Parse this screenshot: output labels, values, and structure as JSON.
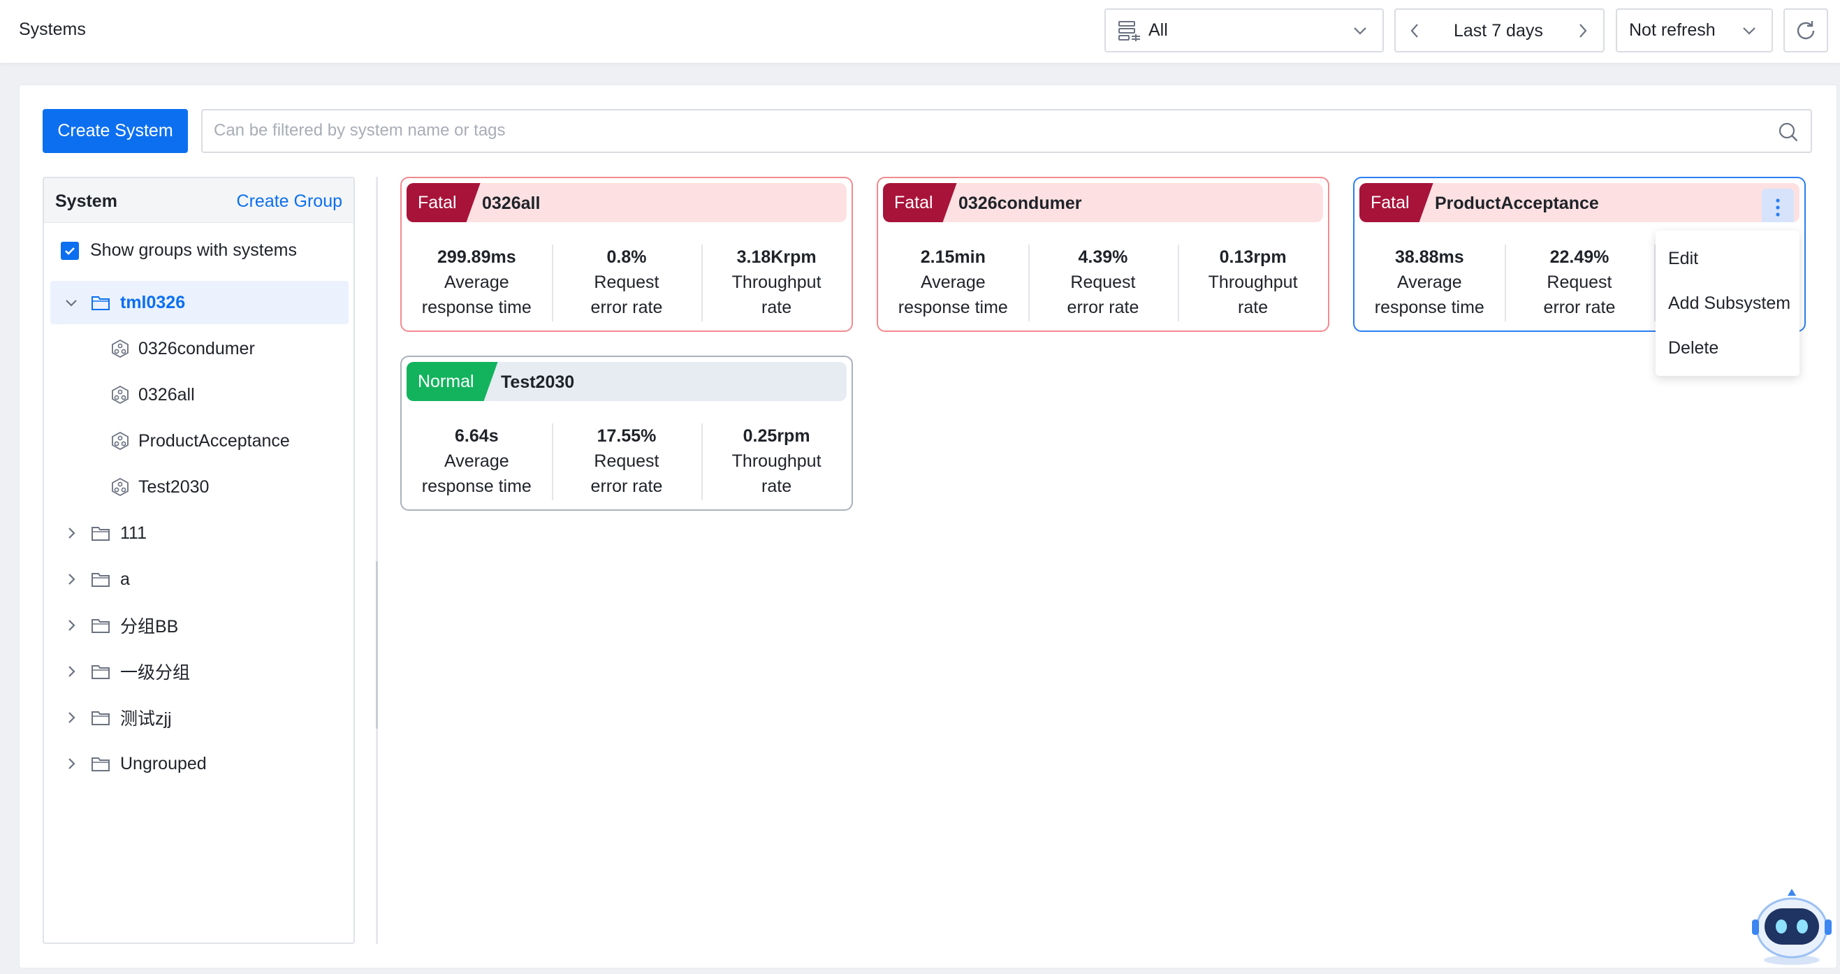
{
  "header": {
    "title": "Systems",
    "system_filter": "All",
    "time_range": "Last 7 days",
    "refresh": "Not refresh"
  },
  "toolbar": {
    "create_label": "Create System",
    "search_placeholder": "Can be filtered by system name or tags"
  },
  "sidebar": {
    "title": "System",
    "create_group": "Create Group",
    "show_groups_label": "Show groups with systems",
    "expanded_group": "tml0326",
    "children": [
      "0326condumer",
      "0326all",
      "ProductAcceptance",
      "Test2030"
    ],
    "groups": [
      "111",
      "a",
      "分组BB",
      "一级分组",
      "测试zjj",
      "Ungrouped"
    ]
  },
  "cards": [
    {
      "status": "Fatal",
      "name": "0326all",
      "metrics": [
        {
          "value": "299.89ms",
          "line1": "Average",
          "line2": "response time"
        },
        {
          "value": "0.8%",
          "line1": "Request",
          "line2": "error rate"
        },
        {
          "value": "3.18Krpm",
          "line1": "Throughput",
          "line2": "rate"
        }
      ]
    },
    {
      "status": "Fatal",
      "name": "0326condumer",
      "metrics": [
        {
          "value": "2.15min",
          "line1": "Average",
          "line2": "response time"
        },
        {
          "value": "4.39%",
          "line1": "Request",
          "line2": "error rate"
        },
        {
          "value": "0.13rpm",
          "line1": "Throughput",
          "line2": "rate"
        }
      ]
    },
    {
      "status": "Fatal",
      "name": "ProductAcceptance",
      "metrics": [
        {
          "value": "38.88ms",
          "line1": "Average",
          "line2": "response time"
        },
        {
          "value": "22.49%",
          "line1": "Request",
          "line2": "error rate"
        },
        {
          "value": "",
          "line1": "",
          "line2": ""
        }
      ]
    },
    {
      "status": "Normal",
      "name": "Test2030",
      "metrics": [
        {
          "value": "6.64s",
          "line1": "Average",
          "line2": "response time"
        },
        {
          "value": "17.55%",
          "line1": "Request",
          "line2": "error rate"
        },
        {
          "value": "0.25rpm",
          "line1": "Throughput",
          "line2": "rate"
        }
      ]
    }
  ],
  "menu": [
    "Edit",
    "Add Subsystem",
    "Delete"
  ],
  "colors": {
    "primary": "#0c6ff0",
    "fatal": "#a8133a",
    "normal": "#13b35e",
    "fatal_border": "#f28b8f"
  },
  "icons": {
    "system_filter": "database-list-icon",
    "reload": "refresh-icon",
    "search": "search-icon",
    "folder": "folder-icon",
    "system": "system-node-icon",
    "more": "more-vertical-icon",
    "assistant": "robot-assistant-icon"
  }
}
